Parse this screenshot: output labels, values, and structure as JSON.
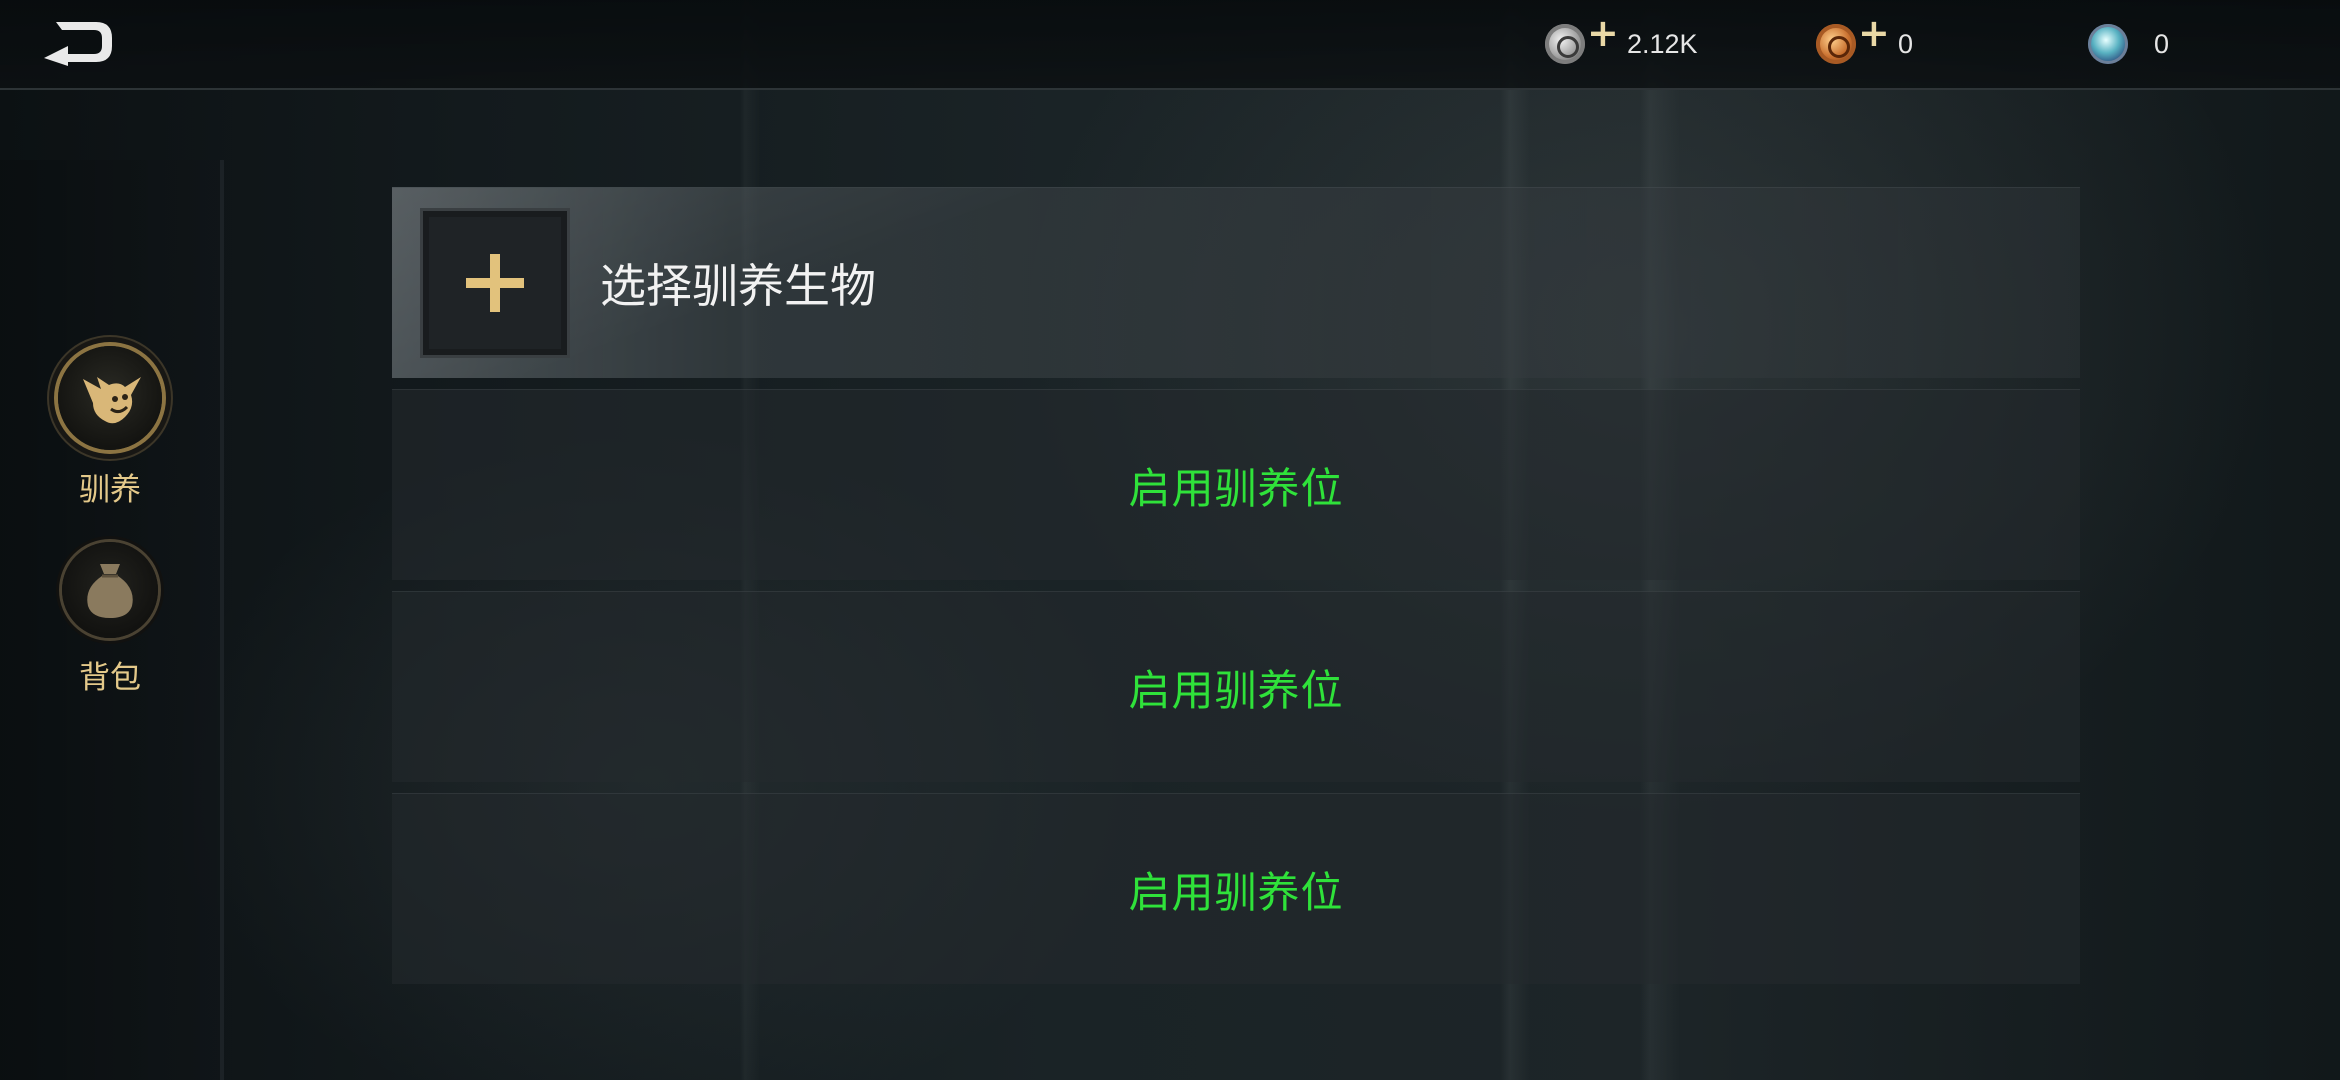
{
  "topbar": {
    "back_icon": "back-arrow-icon",
    "currencies": [
      {
        "icon": "silver-coin-icon",
        "amount": "2.12K",
        "has_plus": true
      },
      {
        "icon": "copper-coin-icon",
        "amount": "0",
        "has_plus": true
      },
      {
        "icon": "gem-orb-icon",
        "amount": "0",
        "has_plus": false
      }
    ],
    "plus_symbol": "+"
  },
  "sidebar": {
    "items": [
      {
        "label": "驯养",
        "icon": "creature-head-icon",
        "active": true
      },
      {
        "label": "背包",
        "icon": "bag-icon",
        "active": false
      }
    ]
  },
  "main": {
    "select_label": "选择驯养生物",
    "enable_label": "启用驯养位",
    "slots": [
      {
        "type": "select",
        "label": "选择驯养生物"
      },
      {
        "type": "locked",
        "label": "启用驯养位"
      },
      {
        "type": "locked",
        "label": "启用驯养位"
      },
      {
        "type": "locked",
        "label": "启用驯养位"
      }
    ]
  },
  "colors": {
    "accent_gold": "#e2c27c",
    "enable_green": "#2fe23a",
    "sidebar_label": "#e4c98a"
  }
}
